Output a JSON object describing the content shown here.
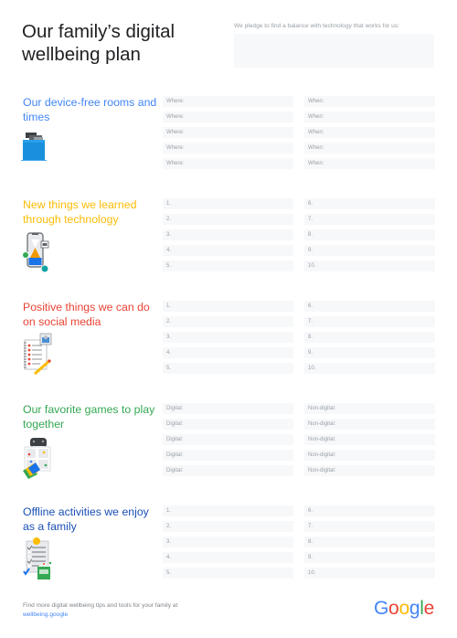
{
  "header": {
    "title": "Our family’s digital wellbeing plan",
    "pledge_label": "We pledge to find a balance with technology that works for us:",
    "pledge_value": ""
  },
  "colors": {
    "blue": "#4285f4",
    "yellow": "#fbbc04",
    "red": "#ea4335",
    "green": "#34a853",
    "dark_blue": "#1a4fb5",
    "field_bg": "#f7f8fa",
    "field_text": "#9aa0a6"
  },
  "sections": [
    {
      "title": "Our device-free rooms and times",
      "color": "#4285f4",
      "icon": "folder-devices-icon",
      "col1": [
        "Where:",
        "Where:",
        "Where:",
        "Where:",
        "Where:"
      ],
      "col2": [
        "When:",
        "When:",
        "When:",
        "When:",
        "When:"
      ]
    },
    {
      "title": "New things we learned through technology",
      "color": "#fbbc04",
      "icon": "smartphone-hourglass-icon",
      "col1": [
        "1.",
        "2.",
        "3.",
        "4.",
        "5."
      ],
      "col2": [
        "6.",
        "7.",
        "8.",
        "9.",
        "10."
      ]
    },
    {
      "title": "Positive things we can do on social media",
      "color": "#ea4335",
      "icon": "notepad-hearts-icon",
      "col1": [
        "1.",
        "2.",
        "3.",
        "4.",
        "5."
      ],
      "col2": [
        "6.",
        "7.",
        "8.",
        "9.",
        "10."
      ]
    },
    {
      "title": "Our favorite games to play together",
      "color": "#34a853",
      "icon": "game-controller-board-icon",
      "col1": [
        "Digital:",
        "Digital:",
        "Digital:",
        "Digital:",
        "Digital:"
      ],
      "col2": [
        "Non-digital:",
        "Non-digital:",
        "Non-digital:",
        "Non-digital:",
        "Non-digital:"
      ]
    },
    {
      "title": "Offline activities we enjoy as a family",
      "color": "#1a4fb5",
      "icon": "checklist-icon",
      "col1": [
        "1.",
        "2.",
        "3.",
        "4.",
        "5."
      ],
      "col2": [
        "6.",
        "7.",
        "8.",
        "9.",
        "10."
      ]
    }
  ],
  "footer": {
    "text": "Find more digital wellbeing tips and tools for your family at ",
    "link": "wellbeing.google"
  },
  "logo": {
    "letters": [
      "G",
      "o",
      "o",
      "g",
      "l",
      "e"
    ],
    "colors": [
      "#4285f4",
      "#ea4335",
      "#fbbc04",
      "#4285f4",
      "#34a853",
      "#ea4335"
    ]
  }
}
